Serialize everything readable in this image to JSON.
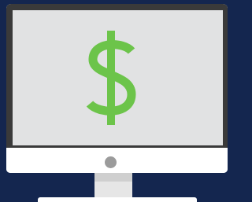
{
  "colors": {
    "background": "#14264f",
    "bezel": "#3a3a3a",
    "screen": "#e1e2e3",
    "dollar": "#6cc44a",
    "monitor_body": "#ffffff",
    "power_button": "#9b9b9b",
    "stand_neck": "#e6e6e6"
  },
  "icons": {
    "screen_symbol": "dollar-sign-icon",
    "power": "power-button-icon"
  }
}
